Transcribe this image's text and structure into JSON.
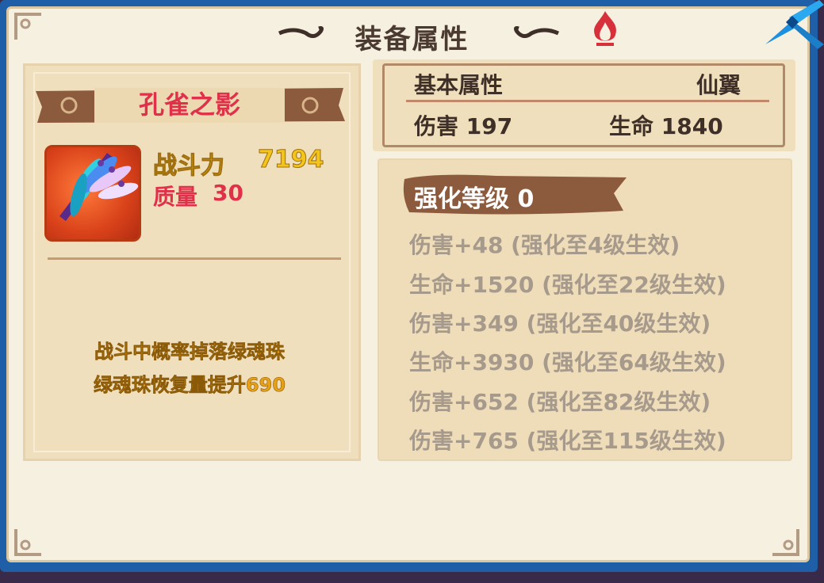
{
  "window": {
    "title": "装备属性"
  },
  "item": {
    "name": "孔雀之影",
    "icon": "peacock-feather-wing-icon",
    "power_label": "战斗力",
    "power_value": "7194",
    "quality_label": "质量",
    "quality_value": "30",
    "effect_lines": [
      "战斗中概率掉落绿魂珠",
      "绿魂珠恢复量提升690"
    ]
  },
  "basic": {
    "title": "基本属性",
    "type": "仙翼",
    "stats": [
      {
        "text": "伤害 197"
      },
      {
        "text": "生命 1840"
      }
    ]
  },
  "enhance": {
    "level_text": "强化等级 0",
    "bonuses": [
      "伤害+48 (强化至4级生效)",
      "生命+1520 (强化至22级生效)",
      "伤害+349 (强化至40级生效)",
      "生命+3930 (强化至64级生效)",
      "伤害+652 (强化至82级生效)",
      "伤害+765 (强化至115级生效)"
    ]
  },
  "colors": {
    "frame": "#1f5fa8",
    "panel": "#f6f0e1",
    "name": "#e0304a",
    "power": "#f3c41a",
    "effect": "#e8a014",
    "inactive_bonus": "#a69a8c",
    "banner": "#8c5a3c"
  }
}
